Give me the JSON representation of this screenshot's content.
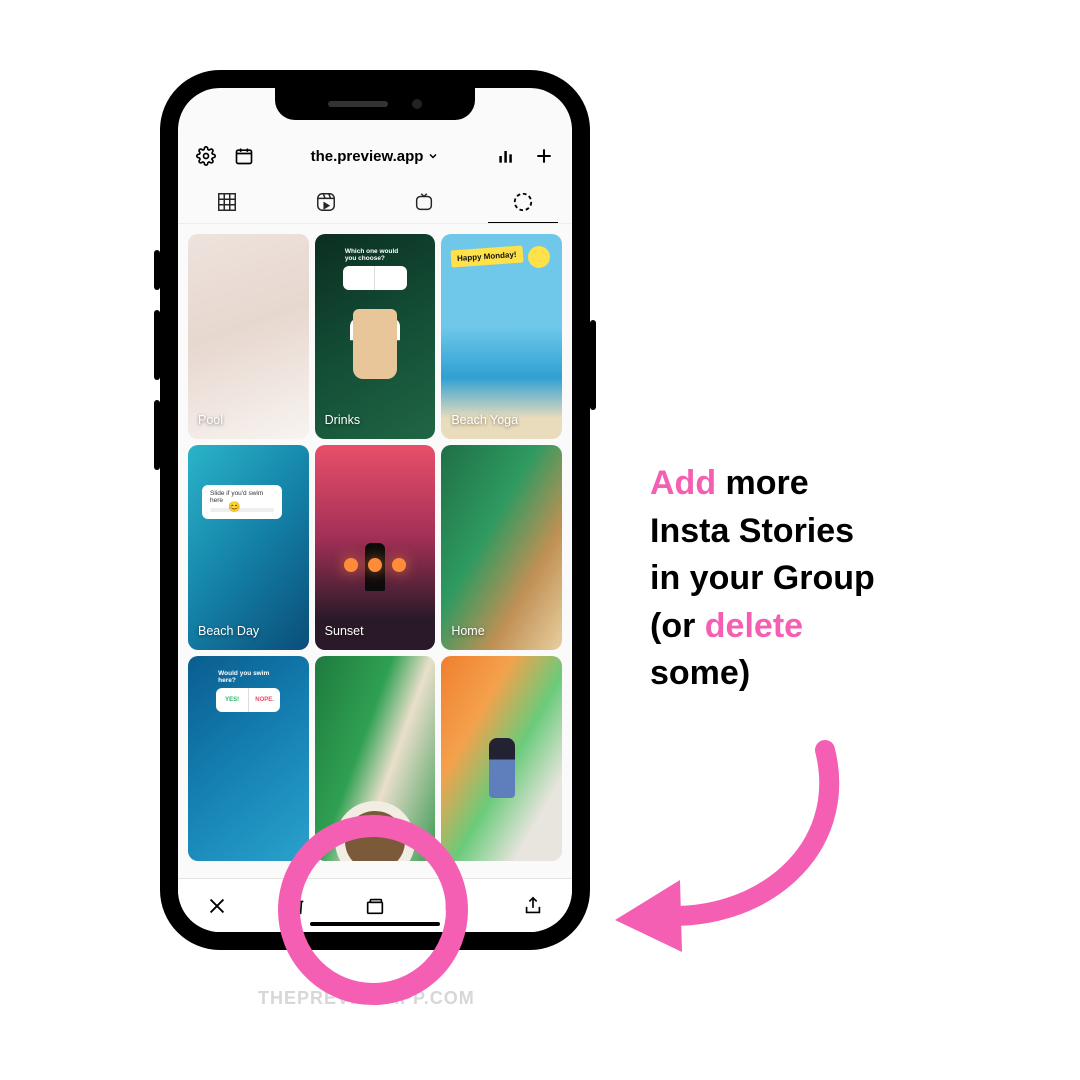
{
  "colors": {
    "accent_pink": "#f55fb3"
  },
  "topbar": {
    "account_label": "the.preview.app"
  },
  "tiles": [
    {
      "label": "Pool"
    },
    {
      "label": "Drinks",
      "overlay_text": "Which one would you choose?"
    },
    {
      "label": "Beach Yoga",
      "badge_text": "Happy Monday!"
    },
    {
      "label": "Beach Day",
      "slider_text": "Slide if you'd swim here"
    },
    {
      "label": "Sunset"
    },
    {
      "label": "Home"
    },
    {
      "label": "",
      "poll_caption": "Would you swim here?",
      "poll_yes": "YES!",
      "poll_no": "NOPE."
    },
    {
      "label": ""
    },
    {
      "label": ""
    }
  ],
  "annotation": {
    "word_add": "Add",
    "line1_rest": " more",
    "line2": "Insta Stories",
    "line3": "in your Group",
    "line4_open": "(or ",
    "word_delete": "delete",
    "line5": "some)"
  },
  "watermark": "THEPREVIEWAPP.COM"
}
